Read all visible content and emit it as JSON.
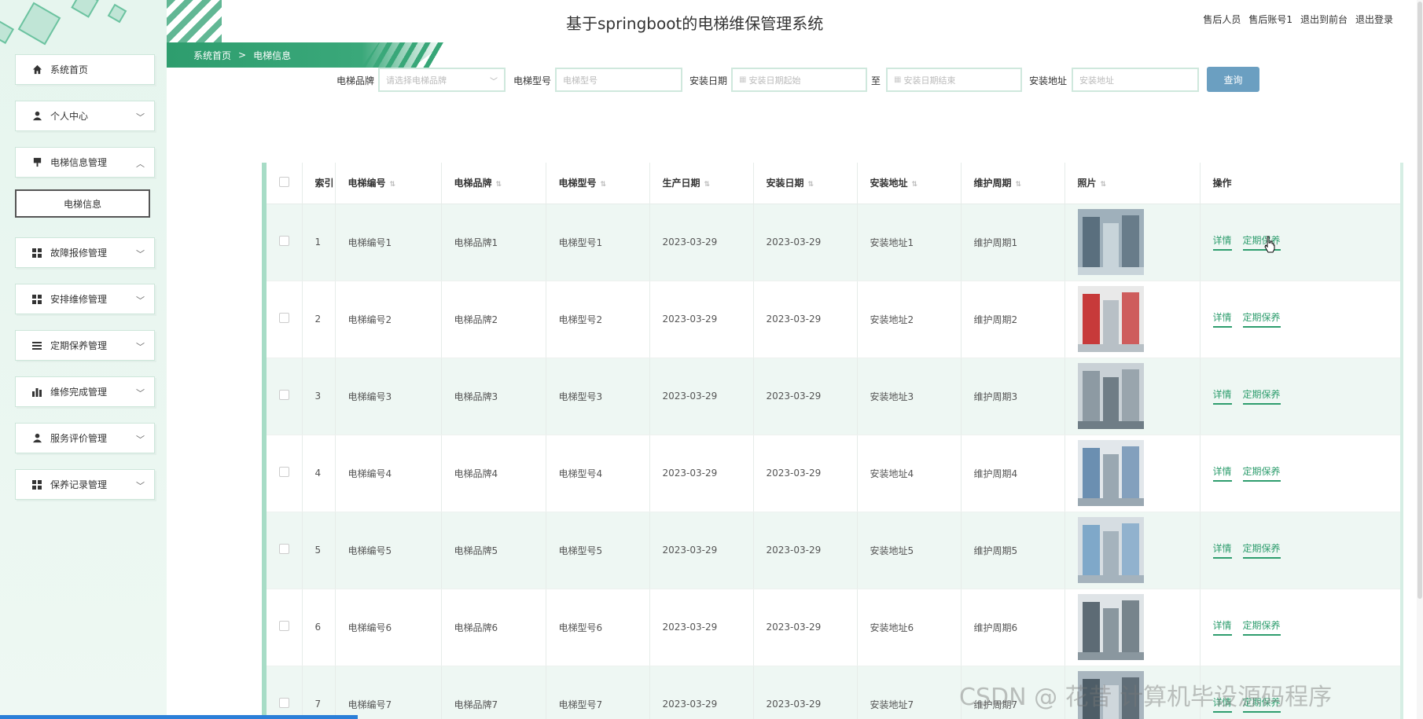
{
  "app": {
    "title": "基于springboot的电梯维保管理系统",
    "header_links": [
      "售后人员",
      "售后账号1",
      "退出到前台",
      "退出登录"
    ]
  },
  "breadcrumb": {
    "home": "系统首页",
    "separator": ">",
    "current": "电梯信息"
  },
  "sidebar": {
    "items": [
      {
        "label": "系统首页",
        "icon": "home-icon"
      },
      {
        "label": "个人中心",
        "icon": "user-icon",
        "chevron": "down"
      },
      {
        "label": "电梯信息管理",
        "icon": "elevator-icon",
        "chevron": "up"
      },
      {
        "label": "故障报修管理",
        "icon": "grid-icon",
        "chevron": "down"
      },
      {
        "label": "安排维修管理",
        "icon": "grid-icon",
        "chevron": "down"
      },
      {
        "label": "定期保养管理",
        "icon": "list-icon",
        "chevron": "down"
      },
      {
        "label": "维修完成管理",
        "icon": "bar-chart-icon",
        "chevron": "down"
      },
      {
        "label": "服务评价管理",
        "icon": "user-icon",
        "chevron": "down"
      },
      {
        "label": "保养记录管理",
        "icon": "grid-icon",
        "chevron": "down"
      }
    ],
    "sub_active": "电梯信息"
  },
  "search": {
    "brand_label": "电梯品牌",
    "brand_placeholder": "请选择电梯品牌",
    "model_label": "电梯型号",
    "model_placeholder": "电梯型号",
    "date_label": "安装日期",
    "date_start_placeholder": "安装日期起始",
    "date_to": "至",
    "date_end_placeholder": "安装日期结束",
    "address_label": "安装地址",
    "address_placeholder": "安装地址",
    "button": "查询"
  },
  "table": {
    "headers": [
      "索引",
      "电梯编号",
      "电梯品牌",
      "电梯型号",
      "生产日期",
      "安装日期",
      "安装地址",
      "维护周期",
      "照片",
      "操作"
    ],
    "rows": [
      {
        "index": "1",
        "code": "电梯编号1",
        "brand": "电梯品牌1",
        "model": "电梯型号1",
        "prod": "2023-03-29",
        "install": "2023-03-29",
        "addr": "安装地址1",
        "cycle": "维护周期1"
      },
      {
        "index": "2",
        "code": "电梯编号2",
        "brand": "电梯品牌2",
        "model": "电梯型号2",
        "prod": "2023-03-29",
        "install": "2023-03-29",
        "addr": "安装地址2",
        "cycle": "维护周期2"
      },
      {
        "index": "3",
        "code": "电梯编号3",
        "brand": "电梯品牌3",
        "model": "电梯型号3",
        "prod": "2023-03-29",
        "install": "2023-03-29",
        "addr": "安装地址3",
        "cycle": "维护周期3"
      },
      {
        "index": "4",
        "code": "电梯编号4",
        "brand": "电梯品牌4",
        "model": "电梯型号4",
        "prod": "2023-03-29",
        "install": "2023-03-29",
        "addr": "安装地址4",
        "cycle": "维护周期4"
      },
      {
        "index": "5",
        "code": "电梯编号5",
        "brand": "电梯品牌5",
        "model": "电梯型号5",
        "prod": "2023-03-29",
        "install": "2023-03-29",
        "addr": "安装地址5",
        "cycle": "维护周期5"
      },
      {
        "index": "6",
        "code": "电梯编号6",
        "brand": "电梯品牌6",
        "model": "电梯型号6",
        "prod": "2023-03-29",
        "install": "2023-03-29",
        "addr": "安装地址6",
        "cycle": "维护周期6"
      },
      {
        "index": "7",
        "code": "电梯编号7",
        "brand": "电梯品牌7",
        "model": "电梯型号7",
        "prod": "2023-03-29",
        "install": "2023-03-29",
        "addr": "安装地址7",
        "cycle": "维护周期7"
      }
    ],
    "op_detail": "详情",
    "op_maintain": "定期保养"
  },
  "watermark": "CSDN @ 花昔 计算机毕设源码程序",
  "colors": {
    "accent": "#2e9d6e",
    "button": "#6b9fc1",
    "row_stripe": "#eef7f3"
  }
}
